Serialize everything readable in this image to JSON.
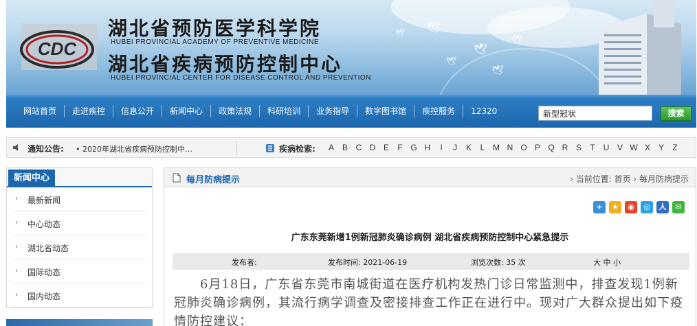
{
  "header": {
    "title_cn_1": "湖北省预防医学科学院",
    "title_en_1": "HUBEI PROVINCIAL ACADEMY OF PREVENTIVE MEDICINE",
    "title_cn_2": "湖北省疾病预防控制中心",
    "title_en_2": "HUBEI PROVINCIAL CENTER FOR DISEASE CONTROL AND PREVENTION",
    "logo_text": "CDC"
  },
  "nav": {
    "items": [
      "网站首页",
      "走进疾控",
      "信息公开",
      "新闻中心",
      "政策法规",
      "科研培训",
      "业务指导",
      "数字图书馆",
      "疾控服务",
      "12320"
    ],
    "search_value": "新型冠状",
    "search_button": "搜索"
  },
  "notice": {
    "label": "通知公告:",
    "text": "• 2020年湖北省疾病预防控制中…",
    "disease_label": "疾病检索:",
    "letters": [
      "A",
      "B",
      "C",
      "D",
      "E",
      "F",
      "G",
      "H",
      "I",
      "J",
      "K",
      "L",
      "M",
      "N",
      "O",
      "P",
      "Q",
      "R",
      "S",
      "T",
      "U",
      "V",
      "W",
      "X",
      "Y",
      "Z"
    ]
  },
  "sidebar": {
    "title": "新闻中心",
    "items": [
      "最新新闻",
      "中心动态",
      "湖北省动态",
      "国际动态",
      "国内动态"
    ]
  },
  "main": {
    "section_title": "每月防病提示",
    "breadcrumb": "› 当前位置: 首页 › 每月防病提示",
    "article_title": "广东东莞新增1例新冠肺炎确诊病例 湖北省疾病预防控制中心紧急提示",
    "meta": {
      "publisher_label": "发布者:",
      "time_label": "发布时间: 2021-06-19",
      "views_label": "浏览次数: 35 次",
      "font_size_label": "大 中 小"
    },
    "body": "6月18日，广东省东莞市南城街道在医疗机构发热门诊日常监测中，排查发现1例新冠肺炎确诊病例，其流行病学调查及密接排查工作正在进行中。现对广大群众提出如下疫情防控建议："
  },
  "colors": {
    "nav_blue": "#1c66ad",
    "search_green": "#2c9a2a"
  }
}
